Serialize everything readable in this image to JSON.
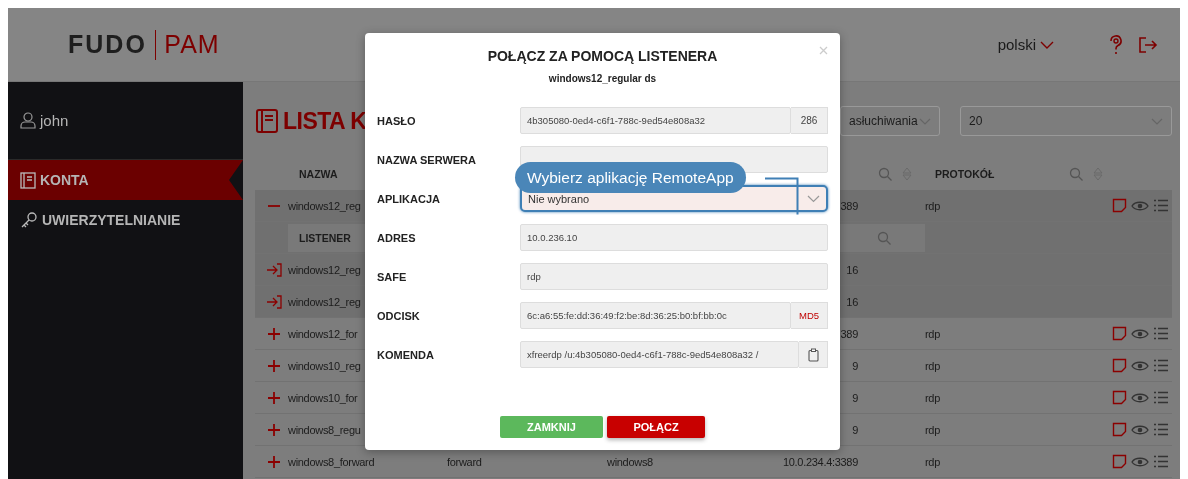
{
  "header": {
    "logo_left": "FUDO",
    "logo_right": "PAM",
    "language": "polski"
  },
  "sidebar": {
    "user": "john",
    "items": [
      {
        "label": "KONTA",
        "selected": true
      },
      {
        "label": "UWIERZYTELNIANIE",
        "selected": false
      }
    ]
  },
  "page": {
    "title": "LISTA K",
    "filters": [
      "asłuchiwania",
      "20"
    ]
  },
  "table": {
    "columns": [
      "NAZWA",
      "PROTOKÓŁ"
    ],
    "rows": [
      {
        "kind": "account",
        "expanded": true,
        "name": "windows12_reg",
        "address": "389",
        "protocol": "rdp"
      },
      {
        "kind": "subheader",
        "name": "LISTENER"
      },
      {
        "kind": "listener",
        "name": "windows12_reg",
        "address": "16"
      },
      {
        "kind": "listener",
        "name": "windows12_reg",
        "address": "16"
      },
      {
        "kind": "account",
        "expanded": false,
        "name": "windows12_for",
        "address": "389",
        "protocol": "rdp"
      },
      {
        "kind": "account",
        "expanded": false,
        "name": "windows10_reg",
        "address": "9",
        "protocol": "rdp"
      },
      {
        "kind": "account",
        "expanded": false,
        "name": "windows10_for",
        "address": "9",
        "protocol": "rdp"
      },
      {
        "kind": "account",
        "expanded": false,
        "name": "windows8_regu",
        "address": "9",
        "protocol": "rdp"
      },
      {
        "kind": "account",
        "expanded": false,
        "name": "windows8_forward",
        "type": "forward",
        "system": "windows8",
        "address": "10.0.234.4:3389",
        "protocol": "rdp"
      }
    ]
  },
  "modal": {
    "title": "POŁĄCZ ZA POMOCĄ LISTENERA",
    "subtitle": "windows12_regular ds",
    "fields": [
      {
        "label": "HASŁO",
        "kind": "input",
        "value": "4b305080-0ed4-c6f1-788c-9ed54e808a32",
        "addon": {
          "kind": "text",
          "text": "286"
        }
      },
      {
        "label": "NAZWA SERWERA",
        "kind": "input"
      },
      {
        "label": "APLIKACJA",
        "kind": "select",
        "value": "Nie wybrano",
        "focused": true
      },
      {
        "label": "ADRES",
        "kind": "input",
        "value": "10.0.236.10"
      },
      {
        "label": "SAFE",
        "kind": "input",
        "value": "rdp"
      },
      {
        "label": "ODCISK",
        "kind": "input",
        "value": "6c:a6:55:fe:dd:36:49:f2:be:8d:36:25:b0:bf:bb:0c",
        "addon": {
          "kind": "hash",
          "text": "MD5"
        }
      },
      {
        "label": "KOMENDA",
        "kind": "input",
        "value": "xfreerdp /u:4b305080-0ed4-c6f1-788c-9ed54e808a32 /",
        "addon": {
          "kind": "clipboard"
        }
      }
    ],
    "tooltip": "Wybierz aplikację RemoteApp",
    "buttons": [
      {
        "label": "ZAMKNIJ",
        "kind": "secondary"
      },
      {
        "label": "POŁĄCZ",
        "kind": "primary"
      }
    ]
  }
}
